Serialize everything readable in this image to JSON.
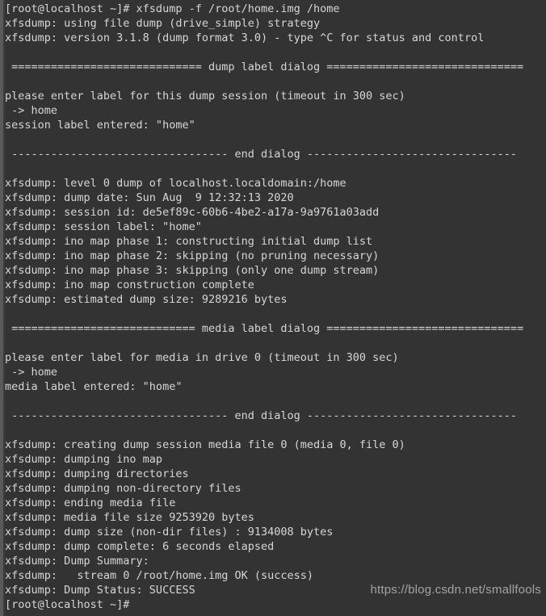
{
  "terminal": {
    "background_color": "#333333",
    "foreground_color": "#d6d6d6",
    "gutter_color": "#5a5a5a",
    "prompt": "[root@localhost ~]#",
    "command": "xfsdump -f /root/home.img /home",
    "lines": [
      "[root@localhost ~]# xfsdump -f /root/home.img /home",
      "xfsdump: using file dump (drive_simple) strategy",
      "xfsdump: version 3.1.8 (dump format 3.0) - type ^C for status and control",
      "",
      " ============================= dump label dialog ==============================",
      "",
      "please enter label for this dump session (timeout in 300 sec)",
      " -> home",
      "session label entered: \"home\"",
      "",
      " --------------------------------- end dialog --------------------------------",
      "",
      "xfsdump: level 0 dump of localhost.localdomain:/home",
      "xfsdump: dump date: Sun Aug  9 12:32:13 2020",
      "xfsdump: session id: de5ef89c-60b6-4be2-a17a-9a9761a03add",
      "xfsdump: session label: \"home\"",
      "xfsdump: ino map phase 1: constructing initial dump list",
      "xfsdump: ino map phase 2: skipping (no pruning necessary)",
      "xfsdump: ino map phase 3: skipping (only one dump stream)",
      "xfsdump: ino map construction complete",
      "xfsdump: estimated dump size: 9289216 bytes",
      "",
      " ============================ media label dialog ==============================",
      "",
      "please enter label for media in drive 0 (timeout in 300 sec)",
      " -> home",
      "media label entered: \"home\"",
      "",
      " --------------------------------- end dialog --------------------------------",
      "",
      "xfsdump: creating dump session media file 0 (media 0, file 0)",
      "xfsdump: dumping ino map",
      "xfsdump: dumping directories",
      "xfsdump: dumping non-directory files",
      "xfsdump: ending media file",
      "xfsdump: media file size 9253920 bytes",
      "xfsdump: dump size (non-dir files) : 9134008 bytes",
      "xfsdump: dump complete: 6 seconds elapsed",
      "xfsdump: Dump Summary:",
      "xfsdump:   stream 0 /root/home.img OK (success)",
      "xfsdump: Dump Status: SUCCESS",
      "[root@localhost ~]#"
    ]
  },
  "watermark": {
    "text": "https://blog.csdn.net/smallfools"
  }
}
